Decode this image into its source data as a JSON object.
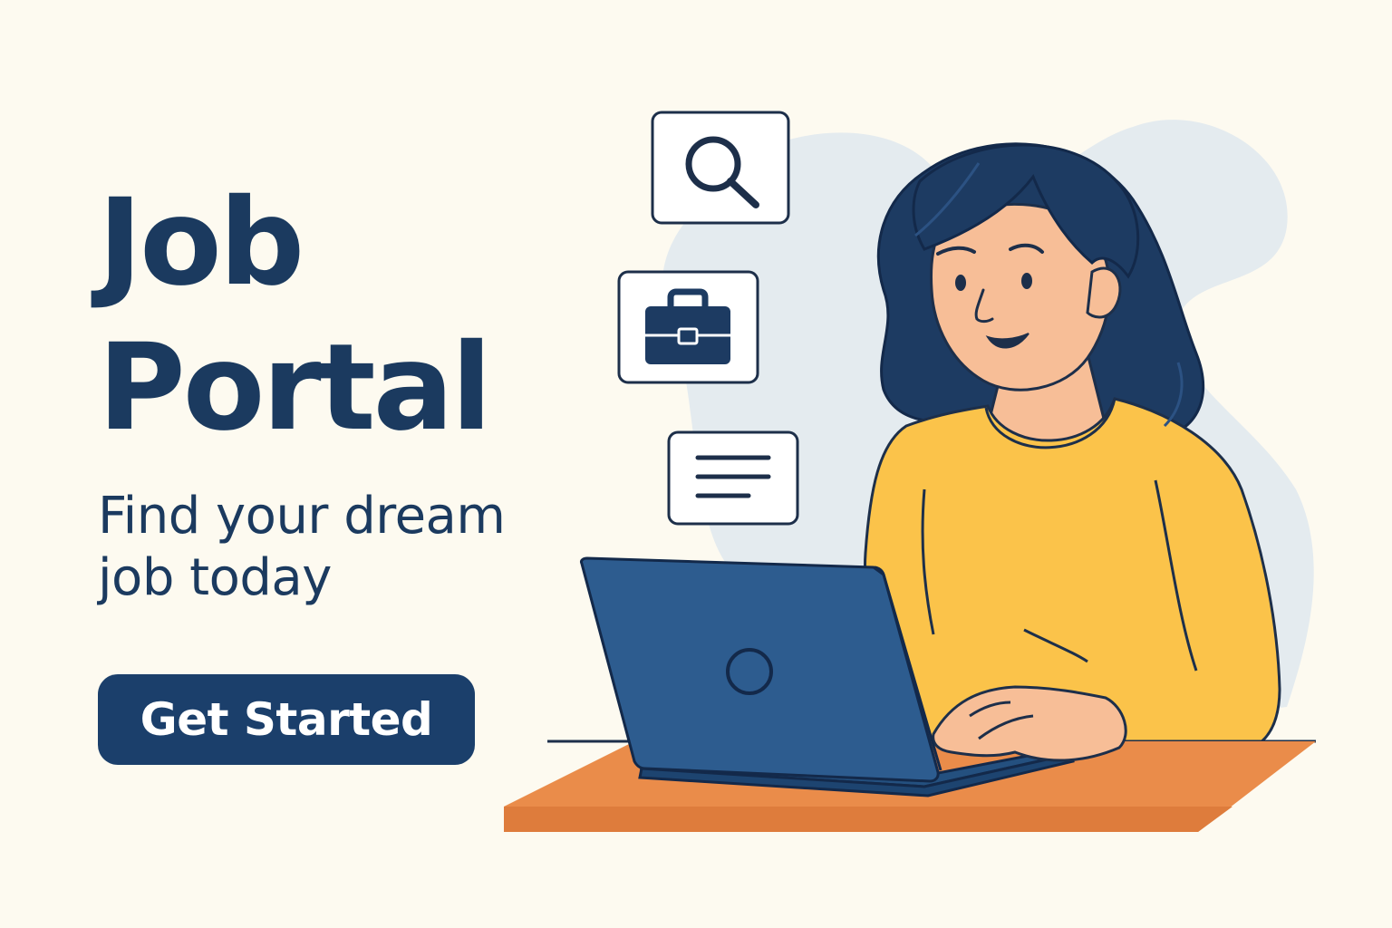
{
  "hero": {
    "title_line1": "Job",
    "title_line2": "Portal",
    "subtitle_line1": "Find your dream",
    "subtitle_line2": "job today",
    "cta_label": "Get Started"
  },
  "icons": [
    "search-icon",
    "briefcase-icon",
    "document-icon"
  ],
  "colors": {
    "background": "#fdfaf0",
    "brand_navy": "#1b3a5f",
    "button": "#1b3f6b",
    "laptop_blue": "#2d5c8f",
    "sweater_yellow": "#fbc34a",
    "skin": "#f7be97",
    "desk_orange": "#ea8c4a",
    "blob": "#e4ebef"
  }
}
